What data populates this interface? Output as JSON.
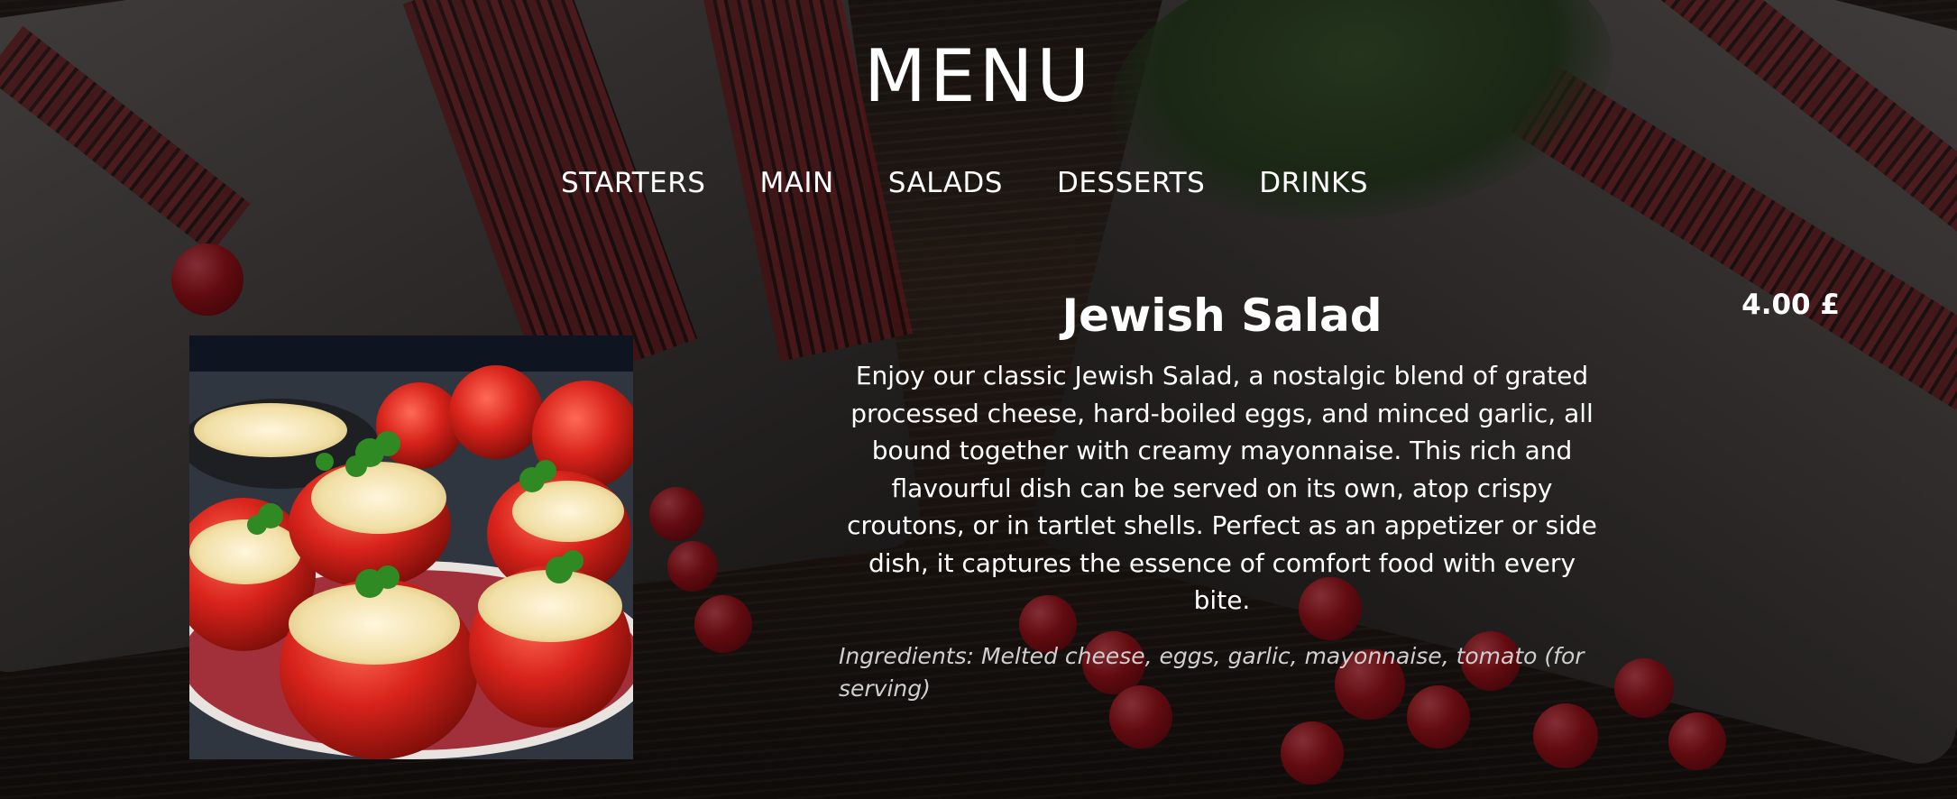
{
  "header": {
    "title": "MENU"
  },
  "nav": {
    "items": [
      "STARTERS",
      "MAIN",
      "SALADS",
      "DESSERTS",
      "DRINKS"
    ]
  },
  "dish": {
    "name": "Jewish Salad",
    "price": "4.00 £",
    "description": "Enjoy our classic Jewish Salad, a nostalgic blend of grated processed cheese, hard-boiled eggs, and minced garlic, all bound together with creamy mayonnaise. This rich and flavourful dish can be served on its own, atop crispy croutons, or in tartlet shells. Perfect as an appetizer or side dish, it captures the essence of comfort food with every bite.",
    "ingredients": "Ingredients: Melted cheese, eggs, garlic, mayonnaise, tomato (for serving)"
  },
  "colors": {
    "text": "#ffffff",
    "muted_text": "#cfcfcf",
    "tomato": "#d8231b",
    "embroidery_red": "#8e2228"
  }
}
